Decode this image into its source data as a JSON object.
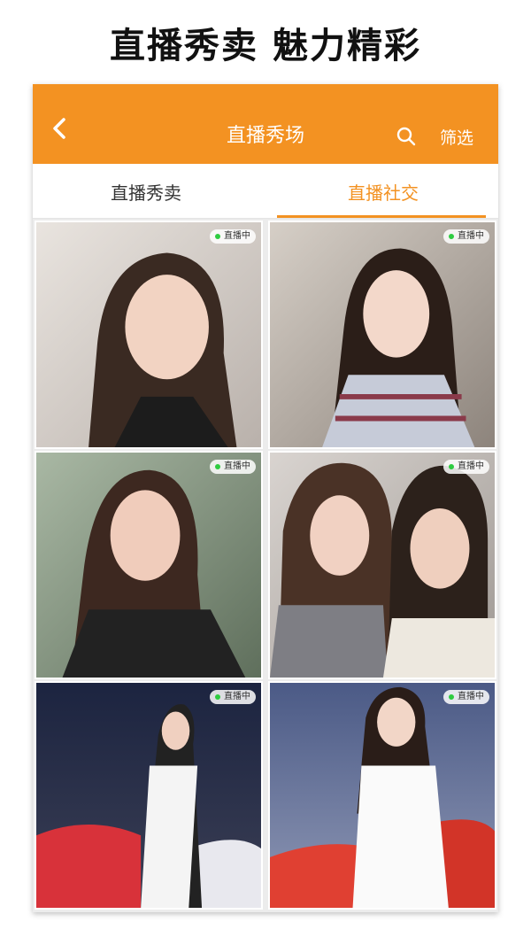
{
  "headline": "直播秀卖 魅力精彩",
  "navbar": {
    "title": "直播秀场",
    "filter_label": "筛选"
  },
  "tabs": [
    {
      "label": "直播秀卖"
    },
    {
      "label": "直播社交"
    }
  ],
  "grid": {
    "items": [
      {
        "badge": "直播中"
      },
      {
        "badge": "直播中"
      },
      {
        "badge": "直播中"
      },
      {
        "badge": "直播中"
      },
      {
        "badge": "直播中"
      },
      {
        "badge": "直播中"
      }
    ]
  },
  "colors": {
    "accent": "#f39222",
    "live_dot": "#2ecc40"
  }
}
